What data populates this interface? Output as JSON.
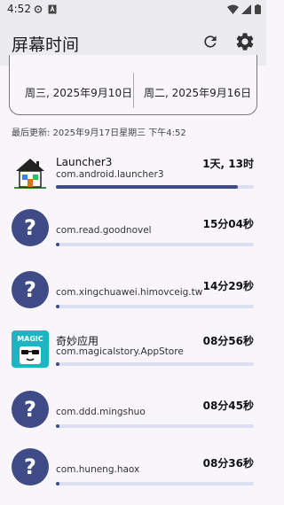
{
  "status_bar": {
    "time": "4:52"
  },
  "app_bar": {
    "title": "屏幕时间"
  },
  "range": {
    "start": "周三, 2025年9月10日",
    "end": "周二, 2025年9月16日"
  },
  "last_updated": "最后更新: 2025年9月17日星期三 下午4:52",
  "apps": [
    {
      "name": "Launcher3",
      "package": "com.android.launcher3",
      "duration": "1天, 13时",
      "progress": 0.92,
      "icon": "house-icon"
    },
    {
      "name": "",
      "package": "com.read.goodnovel",
      "duration": "15分04秒",
      "progress": 0.01,
      "icon": "question-icon"
    },
    {
      "name": "",
      "package": "com.xingchuawei.himovceig.tw",
      "duration": "14分29秒",
      "progress": 0.01,
      "icon": "question-icon"
    },
    {
      "name": "奇妙应用",
      "package": "com.magicalstory.AppStore",
      "duration": "08分56秒",
      "progress": 0.01,
      "icon": "magic-icon"
    },
    {
      "name": "",
      "package": "com.ddd.mingshuo",
      "duration": "08分45秒",
      "progress": 0.01,
      "icon": "question-icon"
    },
    {
      "name": "",
      "package": "com.huneng.haox",
      "duration": "08分36秒",
      "progress": 0.01,
      "icon": "question-icon"
    }
  ],
  "colors": {
    "accent": "#3f4b86",
    "track": "#dcdff2",
    "background": "#f8f6fb",
    "appbar": "#ecebf0"
  }
}
